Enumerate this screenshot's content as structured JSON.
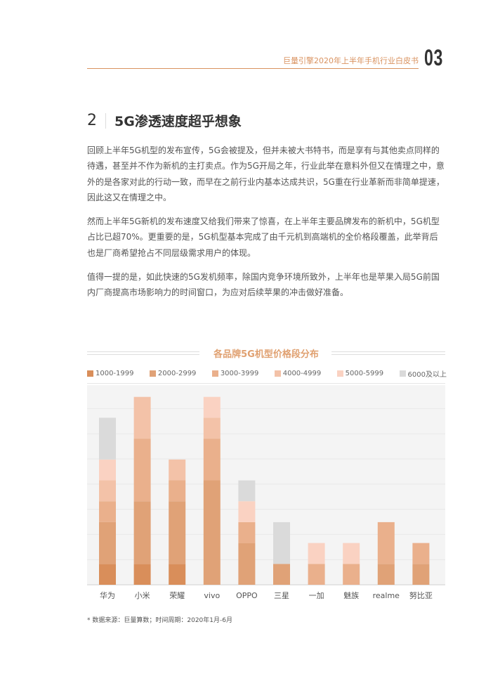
{
  "header": {
    "doc_title": "巨量引擎2020年上半年手机行业白皮书",
    "page_number": "03"
  },
  "section": {
    "number": "2",
    "title": "5G渗透速度超乎想象"
  },
  "paragraphs": [
    {
      "lines": [
        "回顾上半年5G机型的发布宣传，5G会被提及，但并未被大书特书，而是享有与其他卖点同样的",
        "待遇，甚至并不作为新机的主打卖点。作为5G开局之年，行业此举在意料外但又在情理之中，意",
        "外的是各家对此的行动一致，而早在之前行业内基本达成共识，5G重在行业革新而非简单提速，",
        "因此这又在情理之中。"
      ]
    },
    {
      "lines": [
        "然而上半年5G新机的发布速度又给我们带来了惊喜，在上半年主要品牌发布的新机中，5G机型",
        "占比已超70%。更重要的是，5G机型基本完成了由千元机到高端机的全价格段覆盖，此举背后",
        "也是厂商希望抢占不同层级需求用户的体现。"
      ]
    },
    {
      "lines": [
        "值得一提的是，如此快速的5G发机频率，除国内竞争环境所致外，上半年也是苹果入局5G前国",
        "内厂商提高市场影响力的时间窗口，为应对后续苹果的冲击做好准备。"
      ]
    }
  ],
  "chart_data": {
    "type": "bar",
    "stacked": true,
    "title": "各品牌5G机型价格段分布",
    "xlabel": "",
    "ylabel": "",
    "legend_position": "top",
    "grid": true,
    "ylim": [
      0,
      9.5
    ],
    "categories": [
      "华为",
      "小米",
      "荣耀",
      "vivo",
      "OPPO",
      "三星",
      "一加",
      "魅族",
      "realme",
      "努比亚"
    ],
    "series": [
      {
        "name": "1000-1999",
        "color": "#D98E5A",
        "values": [
          1,
          1,
          1,
          0,
          0,
          0,
          0,
          0,
          0,
          0
        ]
      },
      {
        "name": "2000-2999",
        "color": "#E0A277",
        "values": [
          2,
          3,
          3,
          5,
          2,
          1,
          0,
          0,
          1,
          1
        ]
      },
      {
        "name": "3000-3999",
        "color": "#EAB08C",
        "values": [
          1,
          3,
          1,
          2,
          1,
          0,
          1,
          1,
          2,
          1
        ]
      },
      {
        "name": "4000-4999",
        "color": "#F3C2A8",
        "values": [
          1,
          2,
          1,
          1,
          0,
          0,
          0,
          0,
          0,
          0
        ]
      },
      {
        "name": "5000-5999",
        "color": "#FAD2C2",
        "values": [
          1,
          0,
          0,
          1,
          1,
          0,
          1,
          1,
          0,
          0
        ]
      },
      {
        "name": "6000及以上",
        "color": "#DADADA",
        "values": [
          2,
          0,
          0,
          0,
          1,
          2,
          0,
          0,
          0,
          0
        ]
      }
    ]
  },
  "footnote": "* 数据来源：巨量算数；时间周期：2020年1月-6月"
}
